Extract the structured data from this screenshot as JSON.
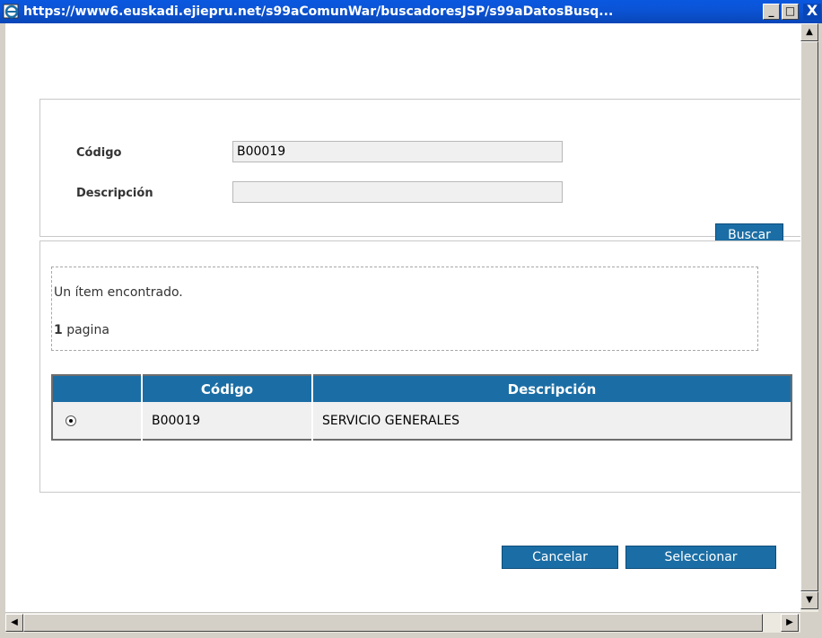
{
  "window": {
    "title": "https://www6.euskadi.ejiepru.net/s99aComunWar/buscadoresJSP/s99aDatosBusq...",
    "minimize": "_",
    "maximize": "□",
    "close": "X"
  },
  "search": {
    "codigo_label": "Código",
    "codigo_value": "B00019",
    "descripcion_label": "Descripción",
    "descripcion_value": "",
    "buscar_label": "Buscar"
  },
  "results": {
    "found_text": "Un ítem encontrado.",
    "page_count": "1",
    "page_label": " pagina",
    "columns": [
      "",
      "Código",
      "Descripción"
    ],
    "rows": [
      {
        "selected": true,
        "codigo": "B00019",
        "descripcion": "SERVICIO GENERALES"
      }
    ]
  },
  "actions": {
    "cancelar_label": "Cancelar",
    "seleccionar_label": "Seleccionar"
  },
  "icons": {
    "window_icon": "ie-icon",
    "scroll_up": "arrow-up-icon",
    "scroll_down": "arrow-down-icon",
    "scroll_left": "arrow-left-icon",
    "scroll_right": "arrow-right-icon"
  },
  "colors": {
    "accent": "#1b6ea5",
    "titlebar": "#0a58e0",
    "field_bg": "#f0f0f0"
  }
}
